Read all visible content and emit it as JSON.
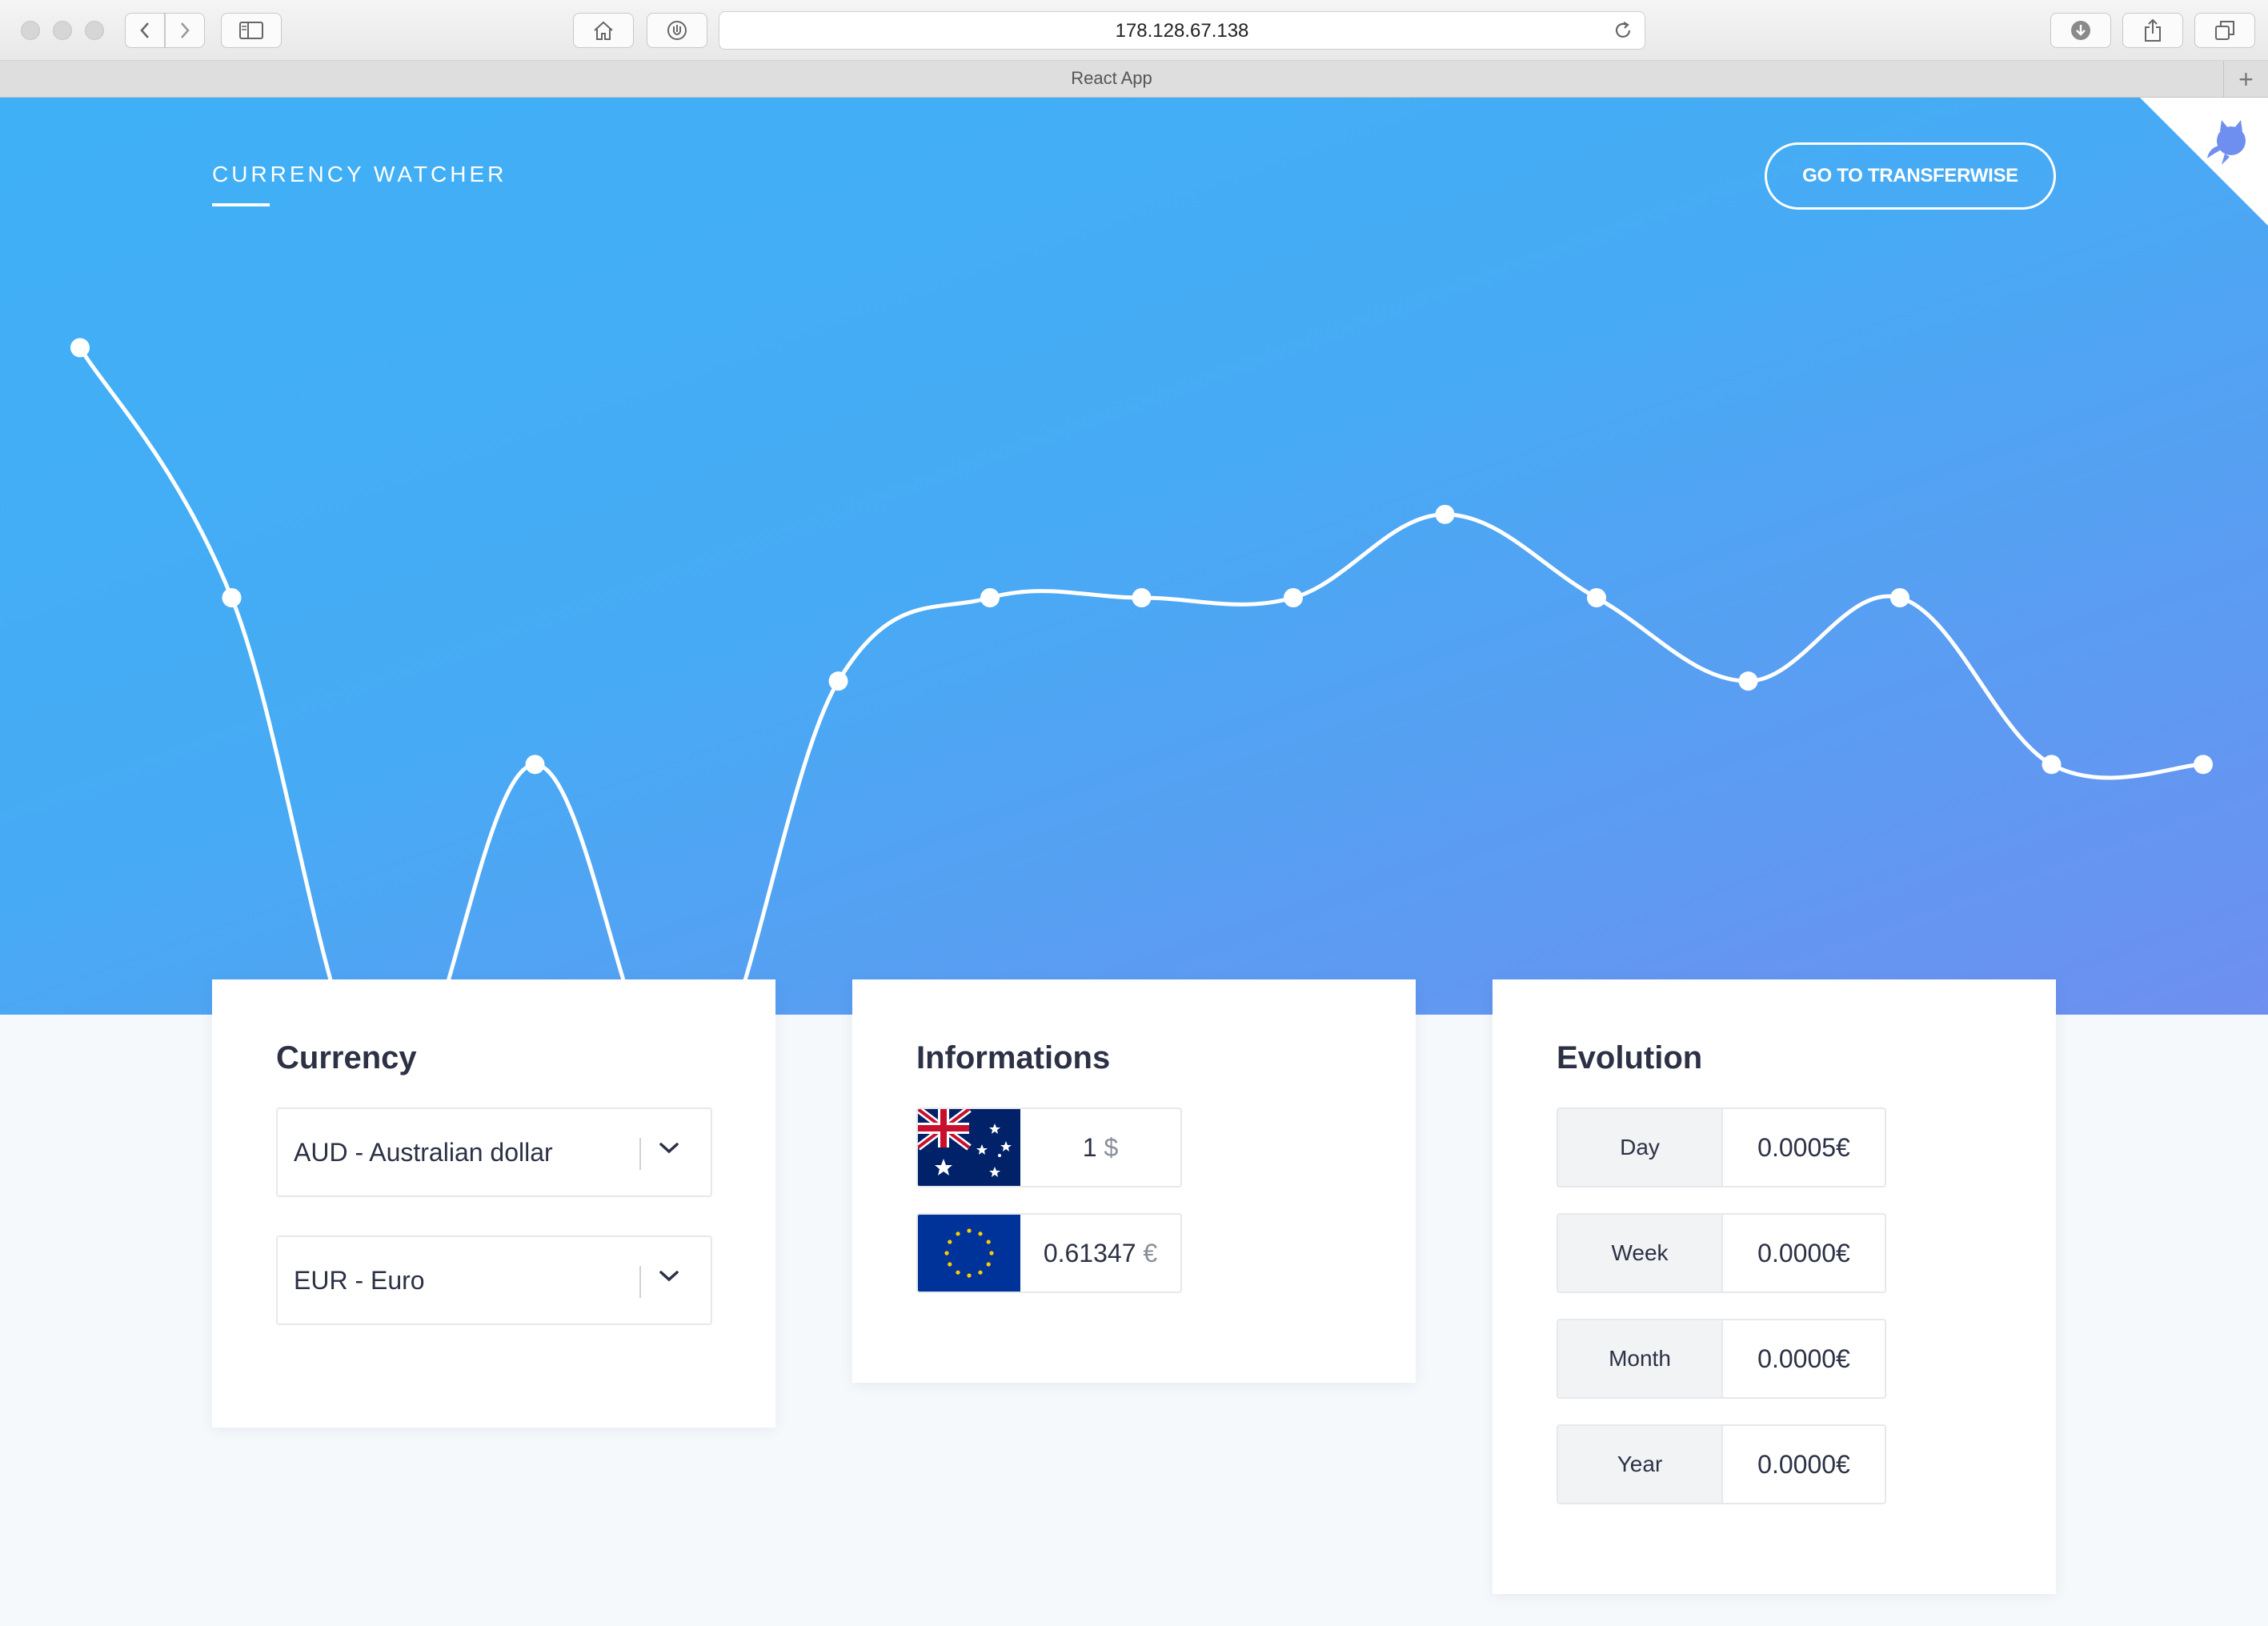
{
  "browser": {
    "url": "178.128.67.138",
    "tab_title": "React App",
    "new_tab_symbol": "+",
    "icons": [
      "back-icon",
      "forward-icon",
      "sidebar-icon",
      "home-icon",
      "shield-icon",
      "reload-icon",
      "download-icon",
      "share-icon",
      "tabs-icon"
    ]
  },
  "header": {
    "brand": "CURRENCY WATCHER",
    "cta_label": "GO TO TRANSFERWISE"
  },
  "colors": {
    "gradient_start": "#3fb0f6",
    "gradient_end": "#6e8ff0",
    "text_dark": "#2c3145"
  },
  "chart_data": {
    "type": "line",
    "smooth": true,
    "color": "#ffffff",
    "values": [
      0.0009,
      0.0006,
      0.0,
      0.0004,
      0.0,
      0.0005,
      0.0006,
      0.0006,
      0.0006,
      0.0007,
      0.0006,
      0.0005,
      0.0006,
      0.0004,
      0.0004
    ],
    "ylim": [
      0,
      0.0012
    ],
    "grid": false,
    "xlabel": "",
    "ylabel": ""
  },
  "currency_card": {
    "title": "Currency",
    "from": "AUD - Australian dollar",
    "to": "EUR - Euro"
  },
  "info_card": {
    "title": "Informations",
    "from_amount": "1",
    "from_symbol": "$",
    "to_amount": "0.61347",
    "to_symbol": "€"
  },
  "evolution_card": {
    "title": "Evolution",
    "rows": [
      {
        "label": "Day",
        "value": "0.0005€"
      },
      {
        "label": "Week",
        "value": "0.0000€"
      },
      {
        "label": "Month",
        "value": "0.0000€"
      },
      {
        "label": "Year",
        "value": "0.0000€"
      }
    ]
  }
}
